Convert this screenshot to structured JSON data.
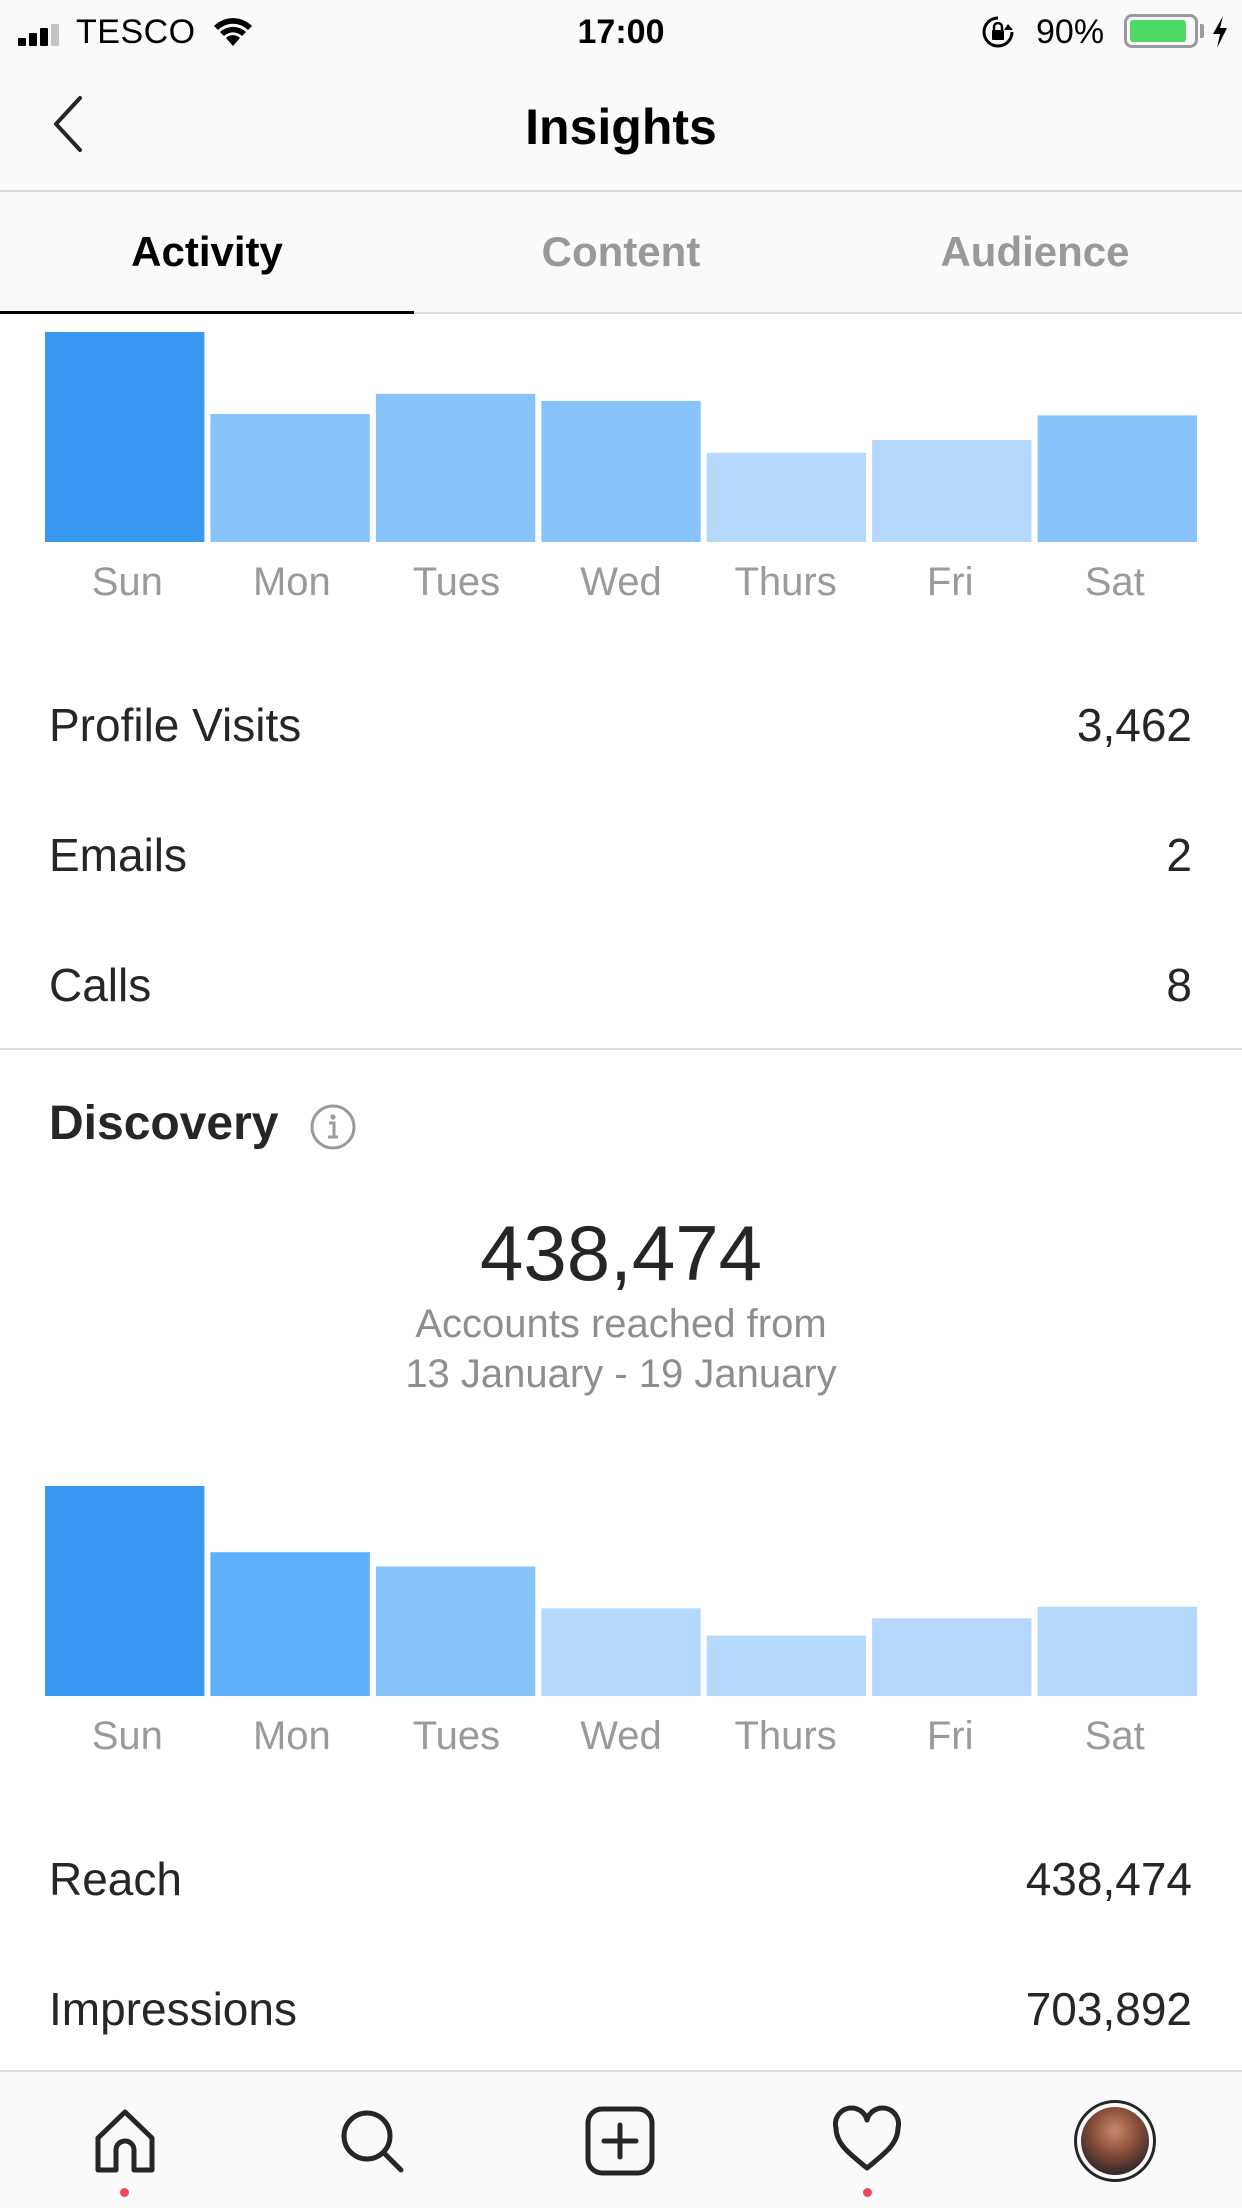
{
  "status_bar": {
    "carrier": "TESCO",
    "time": "17:00",
    "battery_percent": "90%",
    "battery_level": 0.9,
    "battery_color": "#4cd964"
  },
  "header": {
    "title": "Insights",
    "back_icon": "chevron-left-icon"
  },
  "tabs": [
    {
      "label": "Activity",
      "active": true
    },
    {
      "label": "Content",
      "active": false
    },
    {
      "label": "Audience",
      "active": false
    }
  ],
  "activity": {
    "chart_data": {
      "type": "bar",
      "categories": [
        "Sun",
        "Mon",
        "Tues",
        "Wed",
        "Thurs",
        "Fri",
        "Sat"
      ],
      "values": [
        146,
        89,
        103,
        98,
        62,
        71,
        88
      ],
      "ylim": [
        0,
        146
      ],
      "colors": [
        "#3897f0",
        "#88c3fb",
        "#88c3fb",
        "#88c3fb",
        "#b5d9fc",
        "#b5d9fc",
        "#88c3fb"
      ]
    },
    "stats": [
      {
        "label": "Profile Visits",
        "value": "3,462"
      },
      {
        "label": "Emails",
        "value": "2"
      },
      {
        "label": "Calls",
        "value": "8"
      }
    ]
  },
  "discovery": {
    "title": "Discovery",
    "info_icon": "info-icon",
    "accounts_reached": "438,474",
    "caption_line1": "Accounts reached from",
    "caption_line2": "13 January - 19 January",
    "chart_data": {
      "type": "bar",
      "categories": [
        "Sun",
        "Mon",
        "Tues",
        "Wed",
        "Thurs",
        "Fri",
        "Sat"
      ],
      "values": [
        146,
        100,
        90,
        61,
        42,
        54,
        62
      ],
      "ylim": [
        0,
        146
      ],
      "colors": [
        "#3897f0",
        "#5eb0fa",
        "#88c3fb",
        "#b5d9fc",
        "#b5d9fc",
        "#b5d9fc",
        "#b5d9fc"
      ]
    },
    "stats": [
      {
        "label": "Reach",
        "value": "438,474"
      },
      {
        "label": "Impressions",
        "value": "703,892"
      }
    ]
  },
  "bottom_nav": {
    "items": [
      "home-icon",
      "search-icon",
      "add-post-icon",
      "heart-icon",
      "profile-avatar"
    ],
    "notification_color": "#ed4956"
  }
}
